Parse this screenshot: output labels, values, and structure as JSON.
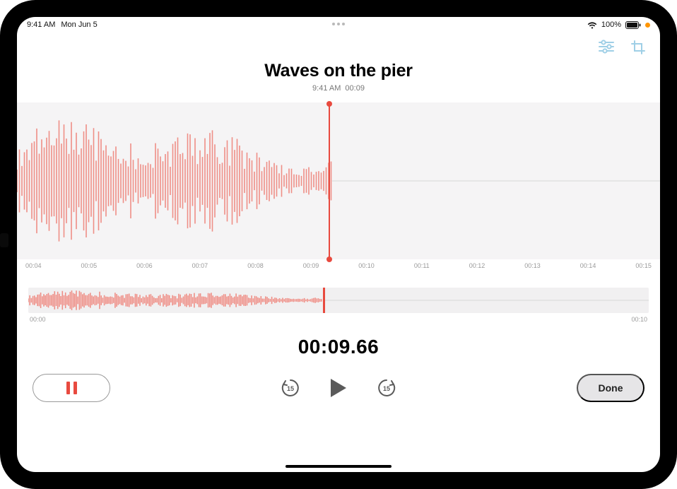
{
  "status": {
    "time": "9:41 AM",
    "date": "Mon Jun 5",
    "battery_text": "100%",
    "wifi_icon": "wifi-icon",
    "battery_icon": "battery-icon",
    "recording_indicator": "orange-dot"
  },
  "toolbar": {
    "options_icon": "sliders-icon",
    "trim_icon": "crop-icon"
  },
  "recording": {
    "title": "Waves on the pier",
    "subtitle_time": "9:41 AM",
    "subtitle_duration": "00:09",
    "elapsed": "00:09.66"
  },
  "ruler": {
    "ticks": [
      "00:04",
      "00:05",
      "00:06",
      "00:07",
      "00:08",
      "00:09",
      "00:10",
      "00:11",
      "00:12",
      "00:13",
      "00:14",
      "00:15"
    ]
  },
  "overview": {
    "start_label": "00:00",
    "end_label": "00:10"
  },
  "controls": {
    "pause_icon": "pause-icon",
    "skip_back_icon": "skip-back-15-icon",
    "skip_back_value": "15",
    "play_icon": "play-icon",
    "skip_fwd_icon": "skip-forward-15-icon",
    "skip_fwd_value": "15",
    "done_label": "Done"
  },
  "colors": {
    "accent_red": "#e84a3f",
    "toolbar_blue": "#9fcfe6",
    "panel_bg": "#f5f4f5",
    "pill_bg": "#e6e5e7"
  }
}
